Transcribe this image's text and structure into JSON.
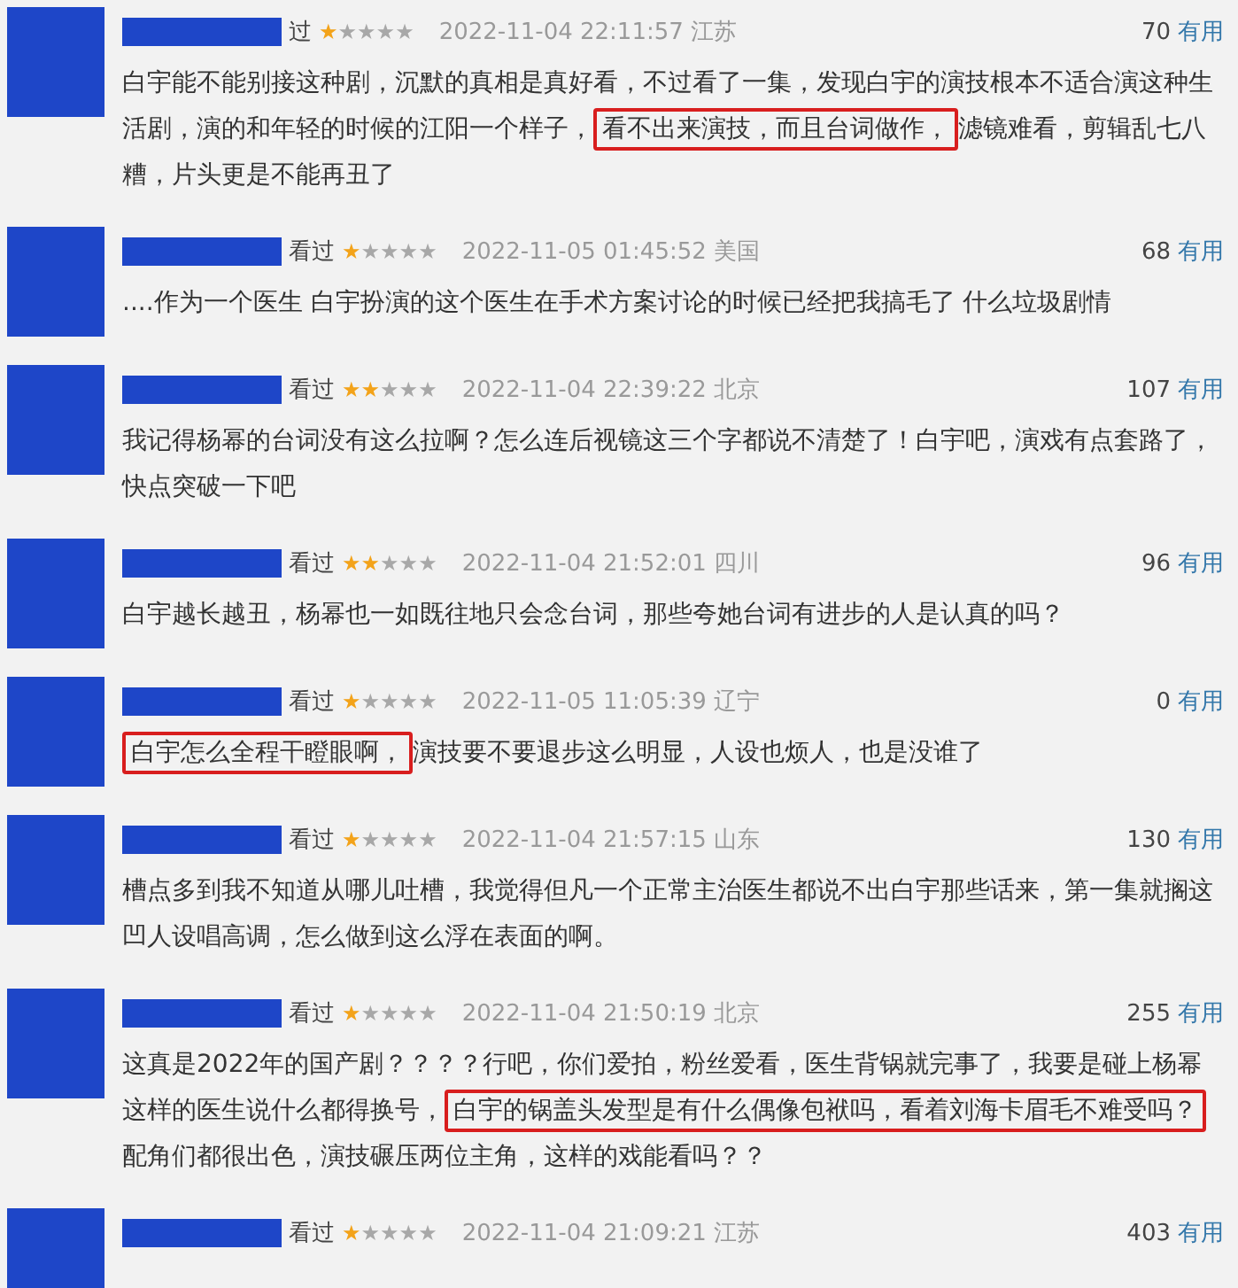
{
  "reviews": [
    {
      "status": "过",
      "stars": 1,
      "time": "2022-11-04 22:11:57 江苏",
      "votes": "70",
      "useful": "有用",
      "body": [
        {
          "text": "白宇能不能别接这种剧，沉默的真相是真好看，不过看了一集，发现白宇的演技根本不适合演这种生活剧，演的和年轻的时候的江阳一个样子，",
          "highlighted": false
        },
        {
          "text": "看不出来演技，而且台词做作，",
          "highlighted": true
        },
        {
          "text": "滤镜难看，剪辑乱七八糟，片头更是不能再丑了",
          "highlighted": false
        }
      ]
    },
    {
      "status": "看过",
      "stars": 1,
      "time": "2022-11-05 01:45:52 美国",
      "votes": "68",
      "useful": "有用",
      "body": [
        {
          "text": "....作为一个医生 白宇扮演的这个医生在手术方案讨论的时候已经把我搞毛了 什么垃圾剧情",
          "highlighted": false
        }
      ]
    },
    {
      "status": "看过",
      "stars": 2,
      "time": "2022-11-04 22:39:22 北京",
      "votes": "107",
      "useful": "有用",
      "body": [
        {
          "text": "我记得杨幂的台词没有这么拉啊？怎么连后视镜这三个字都说不清楚了！白宇吧，演戏有点套路了，快点突破一下吧",
          "highlighted": false
        }
      ]
    },
    {
      "status": "看过",
      "stars": 2,
      "time": "2022-11-04 21:52:01 四川",
      "votes": "96",
      "useful": "有用",
      "body": [
        {
          "text": "白宇越长越丑，杨幂也一如既往地只会念台词，那些夸她台词有进步的人是认真的吗？",
          "highlighted": false
        }
      ]
    },
    {
      "status": "看过",
      "stars": 1,
      "time": "2022-11-05 11:05:39 辽宁",
      "votes": "0",
      "useful": "有用",
      "body": [
        {
          "text": "白宇怎么全程干瞪眼啊，",
          "highlighted": true
        },
        {
          "text": "演技要不要退步这么明显，人设也烦人，也是没谁了",
          "highlighted": false
        }
      ]
    },
    {
      "status": "看过",
      "stars": 1,
      "time": "2022-11-04 21:57:15 山东",
      "votes": "130",
      "useful": "有用",
      "body": [
        {
          "text": "槽点多到我不知道从哪儿吐槽，我觉得但凡一个正常主治医生都说不出白宇那些话来，第一集就搁这凹人设唱高调，怎么做到这么浮在表面的啊。",
          "highlighted": false
        }
      ]
    },
    {
      "status": "看过",
      "stars": 1,
      "time": "2022-11-04 21:50:19 北京",
      "votes": "255",
      "useful": "有用",
      "body": [
        {
          "text": "这真是2022年的国产剧？？？？行吧，你们爱拍，粉丝爱看，医生背锅就完事了，我要是碰上杨幂这样的医生说什么都得换号，",
          "highlighted": false
        },
        {
          "text": "白宇的锅盖头发型是有什么偶像包袱吗，看着刘海卡眉毛不难受吗？",
          "highlighted": true
        },
        {
          "text": "配角们都很出色，演技碾压两位主角，这样的戏能看吗？？",
          "highlighted": false
        }
      ]
    },
    {
      "status": "看过",
      "stars": 1,
      "time": "2022-11-04 21:09:21 江苏",
      "votes": "403",
      "useful": "有用"
    }
  ]
}
